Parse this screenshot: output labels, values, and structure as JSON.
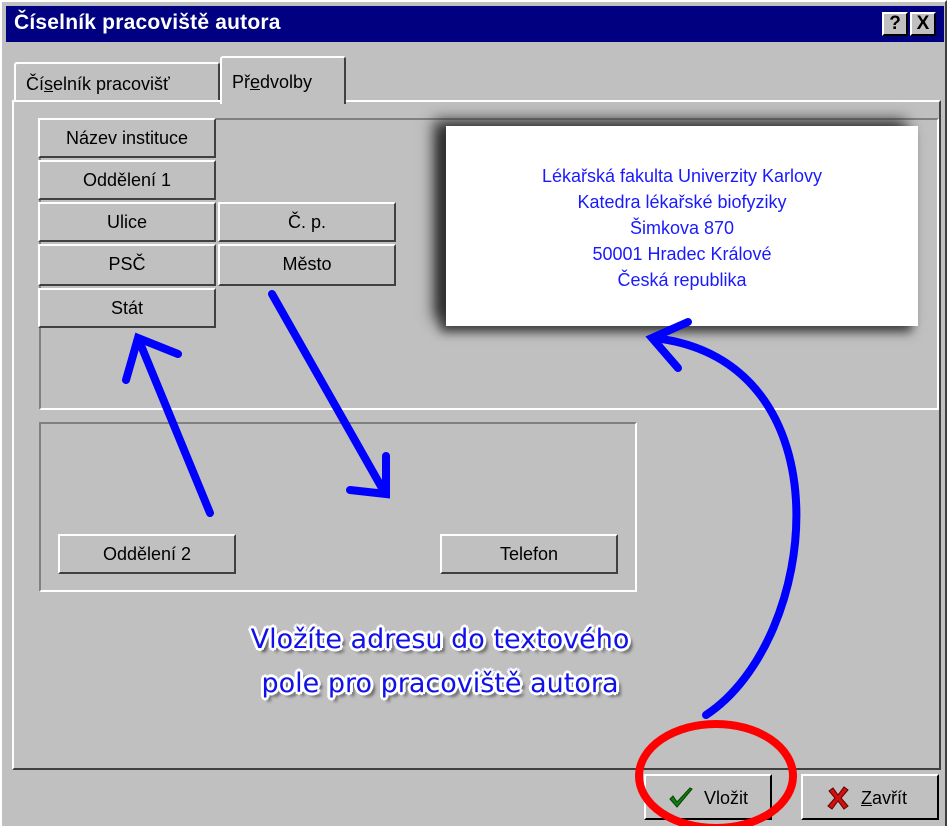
{
  "window": {
    "title": "Číselník pracoviště autora",
    "help_btn": "?",
    "close_btn": "X"
  },
  "tabs": [
    {
      "label_pre": "Čí",
      "label_ul": "s",
      "label_post": "elník pracovišť"
    },
    {
      "label_pre": "Př",
      "label_ul": "e",
      "label_post": "dvolby"
    }
  ],
  "fields": {
    "nazev_instituce": "Název instituce",
    "oddeleni_1": "Oddělení 1",
    "ulice": "Ulice",
    "cp": "Č. p.",
    "psc": "PSČ",
    "mesto": "Město",
    "stat": "Stát",
    "oddeleni_2": "Oddělení 2",
    "telefon": "Telefon"
  },
  "preview": {
    "lines": [
      "Lékařská fakulta Univerzity Karlovy",
      "Katedra lékařské biofyziky",
      "Šimkova  870",
      "50001  Hradec Králové",
      "Česká republika"
    ],
    "color": "#1a1aff"
  },
  "annotation": {
    "line1": "Vložíte adresu do textového",
    "line2": "pole pro pracoviště autora",
    "arrow_color": "#0000ff",
    "circle_color": "#ff0000"
  },
  "buttons": {
    "insert": "Vložit",
    "close_ul": "Z",
    "close_post": "avřít"
  },
  "icons": {
    "insert": "check-icon",
    "close": "x-icon"
  }
}
